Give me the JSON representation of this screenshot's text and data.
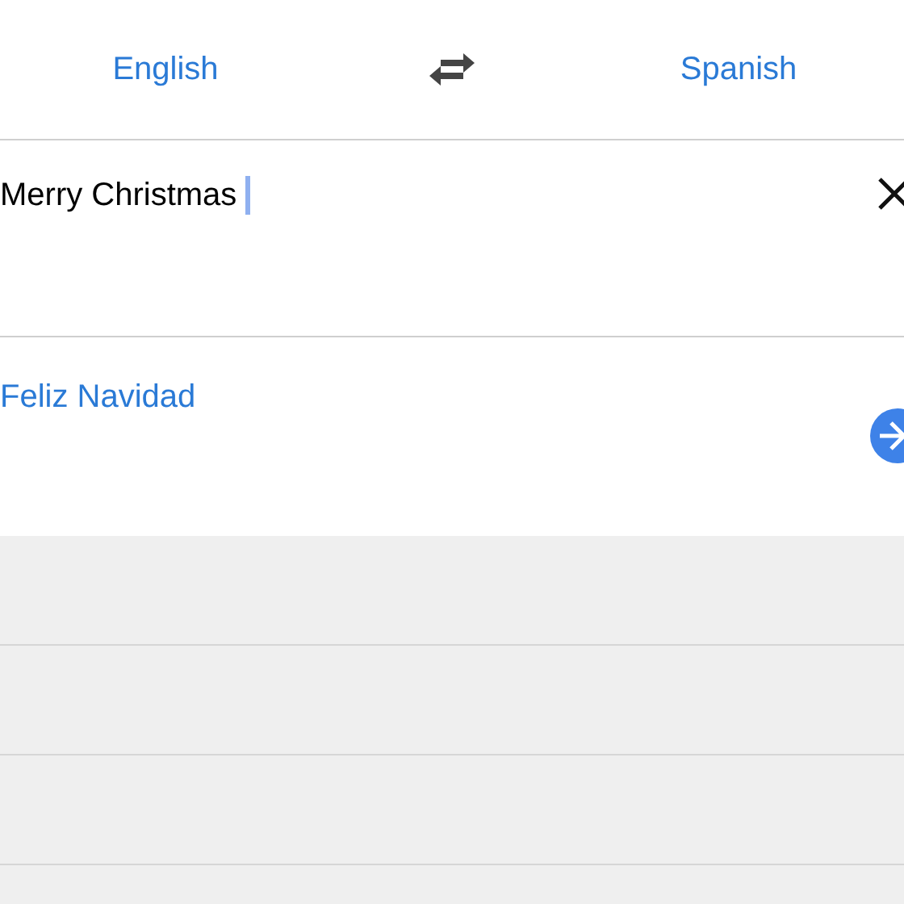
{
  "languages": {
    "source": "English",
    "target": "Spanish"
  },
  "input": {
    "value": "Merry Christmas"
  },
  "translation": {
    "text": "Feliz Navidad"
  }
}
